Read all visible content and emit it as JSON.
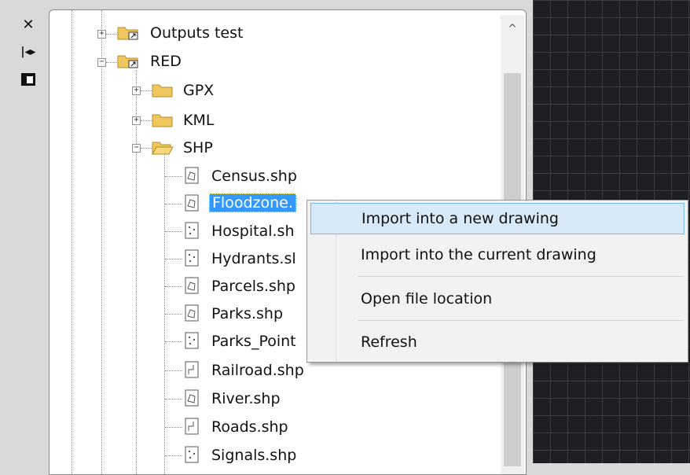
{
  "sidebar": {
    "icons": [
      "close-icon",
      "dock-arrows-icon",
      "panel-icon"
    ]
  },
  "tree": {
    "nodes": [
      {
        "label": "Outputs test",
        "type": "folder-link",
        "expander": "+"
      },
      {
        "label": "RED",
        "type": "folder-link",
        "expander": "−"
      },
      {
        "label": "GPX",
        "type": "folder",
        "expander": "+"
      },
      {
        "label": "KML",
        "type": "folder",
        "expander": "+"
      },
      {
        "label": "SHP",
        "type": "folder",
        "expander": "−"
      },
      {
        "label": "Census.shp",
        "type": "polygon-file"
      },
      {
        "label": "Floodzone.",
        "type": "polygon-file",
        "selected": true
      },
      {
        "label": "Hospital.sh",
        "type": "point-file"
      },
      {
        "label": "Hydrants.sl",
        "type": "point-file"
      },
      {
        "label": "Parcels.shp",
        "type": "polygon-file"
      },
      {
        "label": "Parks.shp",
        "type": "polygon-file"
      },
      {
        "label": "Parks_Point",
        "type": "point-file"
      },
      {
        "label": "Railroad.shp",
        "type": "line-file"
      },
      {
        "label": "River.shp",
        "type": "polygon-file"
      },
      {
        "label": "Roads.shp",
        "type": "line-file"
      },
      {
        "label": "Signals.shp",
        "type": "point-file"
      }
    ]
  },
  "scrollbar": {
    "up_arrow": "^"
  },
  "context_menu": {
    "items": [
      "Import into a new drawing",
      "Import into the current drawing",
      "Open file location",
      "Refresh"
    ],
    "highlighted": "Import into a new drawing"
  },
  "colors": {
    "selection": "#3399ff",
    "menu_highlight": "#d8e9f9",
    "canvas": "#1d1f22"
  }
}
